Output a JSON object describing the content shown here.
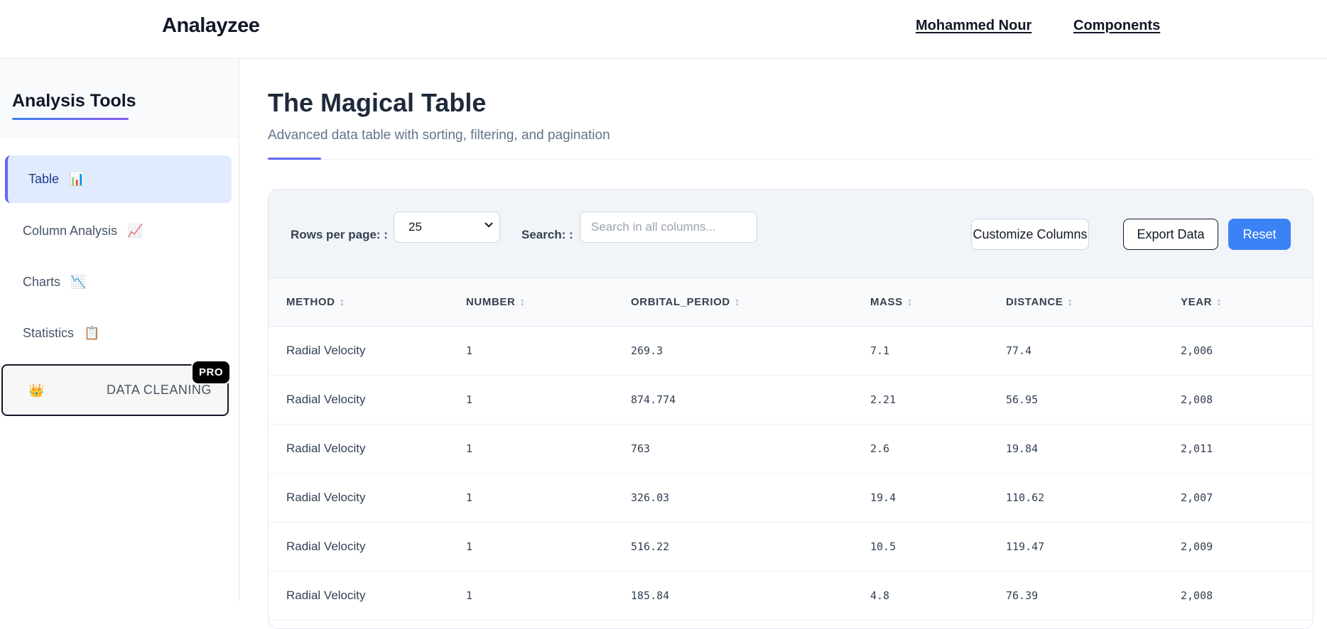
{
  "header": {
    "brand": "Analayzee",
    "links": [
      "Mohammed Nour",
      "Components"
    ]
  },
  "sidebar": {
    "title": "Analysis Tools",
    "items": [
      {
        "label": "Table",
        "icon": "📊",
        "icon_name": "bar-chart-icon",
        "active": true
      },
      {
        "label": "Column Analysis",
        "icon": "📈",
        "icon_name": "chart-increasing-icon",
        "active": false
      },
      {
        "label": "Charts",
        "icon": "📉",
        "icon_name": "chart-decreasing-icon",
        "active": false
      },
      {
        "label": "Statistics",
        "icon": "📋",
        "icon_name": "clipboard-icon",
        "active": false
      }
    ],
    "pro": {
      "label": "DATA CLEANING",
      "icon": "👑",
      "icon_name": "crown-icon",
      "badge": "PRO"
    }
  },
  "main": {
    "title": "The Magical Table",
    "subtitle": "Advanced data table with sorting, filtering, and pagination"
  },
  "controls": {
    "rows_label": "Rows per page: :",
    "rows_value": "25",
    "search_label": "Search: :",
    "search_placeholder": "Search in all columns...",
    "customize_label": "Customize Columns",
    "export_label": "Export Data",
    "reset_label": "Reset"
  },
  "table": {
    "sort_icon": "↕",
    "columns": [
      "METHOD",
      "NUMBER",
      "ORBITAL_PERIOD",
      "MASS",
      "DISTANCE",
      "YEAR"
    ],
    "rows": [
      [
        "Radial Velocity",
        "1",
        "269.3",
        "7.1",
        "77.4",
        "2,006"
      ],
      [
        "Radial Velocity",
        "1",
        "874.774",
        "2.21",
        "56.95",
        "2,008"
      ],
      [
        "Radial Velocity",
        "1",
        "763",
        "2.6",
        "19.84",
        "2,011"
      ],
      [
        "Radial Velocity",
        "1",
        "326.03",
        "19.4",
        "110.62",
        "2,007"
      ],
      [
        "Radial Velocity",
        "1",
        "516.22",
        "10.5",
        "119.47",
        "2,009"
      ],
      [
        "Radial Velocity",
        "1",
        "185.84",
        "4.8",
        "76.39",
        "2,008"
      ]
    ]
  },
  "colors": {
    "accent": "#3b82f6",
    "active_nav_bg": "#e0ecfd",
    "active_nav_border": "#6366f1"
  }
}
